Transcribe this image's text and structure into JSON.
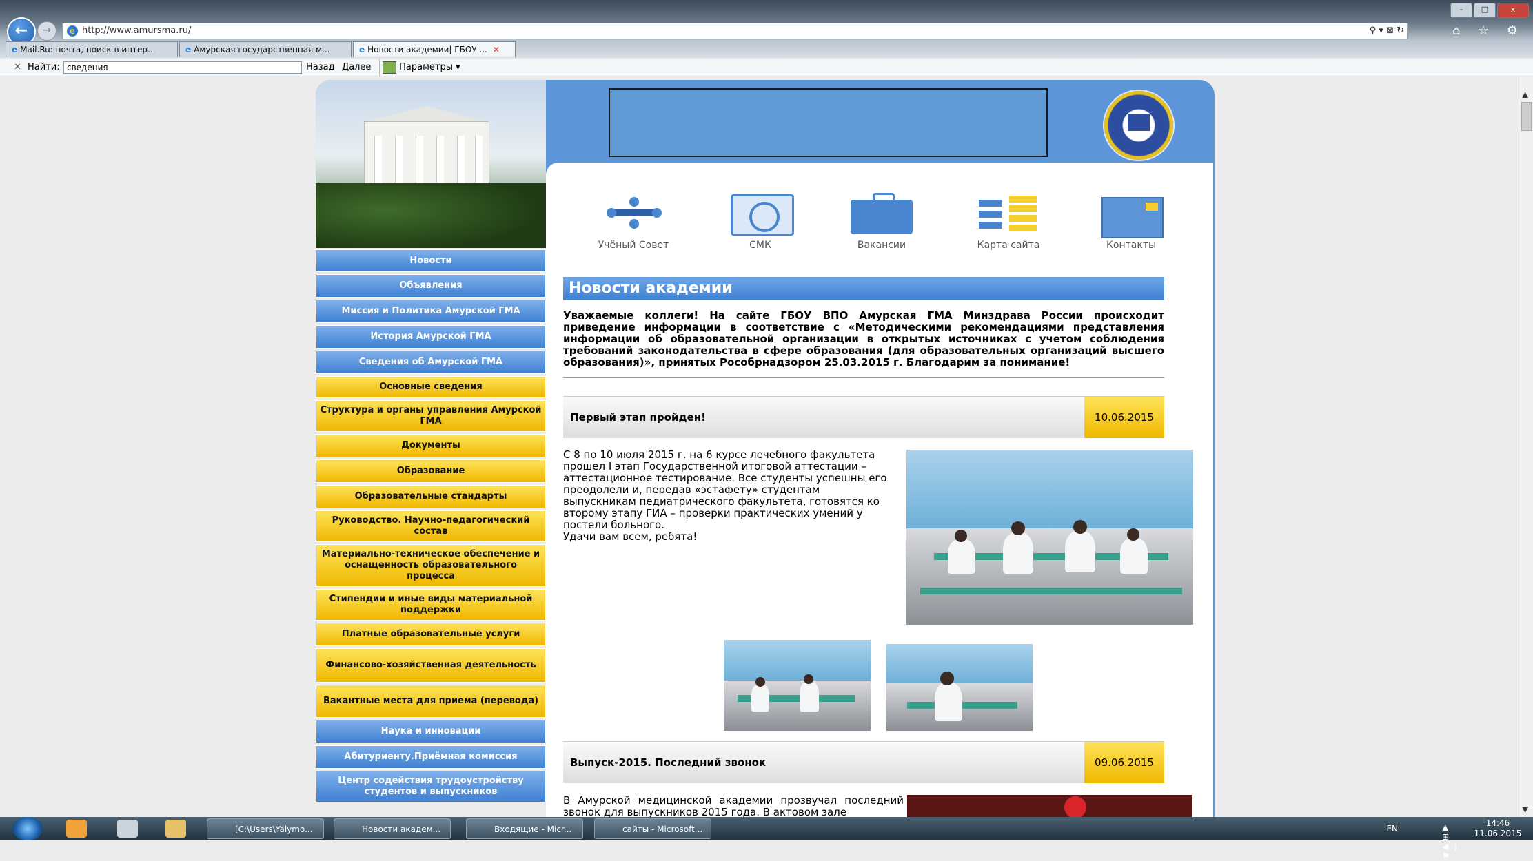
{
  "browser": {
    "url": "http://www.amursma.ru/",
    "addr_tools": "⚲ ▾ ⊠ ↻",
    "right_icons": "⌂ ☆ ⚙",
    "tabs": [
      {
        "label": "Mail.Ru: почта, поиск в интер..."
      },
      {
        "label": "Амурская государственная м..."
      },
      {
        "label": "Новости академии| ГБОУ ..."
      }
    ],
    "window_controls": {
      "minimize": "–",
      "maximize": "□",
      "close": "x"
    }
  },
  "find_bar": {
    "close": "✕",
    "label": "Найти:",
    "value": "сведения",
    "prev": "Назад",
    "next": "Далее",
    "options": "Параметры ▾"
  },
  "site": {
    "icons": [
      {
        "label": "Учёный Совет",
        "icon": "council-icon"
      },
      {
        "label": "СМК",
        "icon": "smk-icon"
      },
      {
        "label": "Вакансии",
        "icon": "briefcase-icon"
      },
      {
        "label": "Карта сайта",
        "icon": "sitemap-icon"
      },
      {
        "label": "Контакты",
        "icon": "envelope-icon"
      }
    ],
    "menu": [
      {
        "label": "Новости",
        "color": "blue"
      },
      {
        "label": "Объявления",
        "color": "blue"
      },
      {
        "label": "Миссия и Политика Амурской ГМА",
        "color": "blue"
      },
      {
        "label": "История Амурской ГМА",
        "color": "blue"
      },
      {
        "label": "Сведения об Амурской ГМА",
        "color": "blue"
      },
      {
        "label": "Основные сведения",
        "color": "yellow"
      },
      {
        "label": "Структура и органы управления Амурской ГМА",
        "color": "yellow"
      },
      {
        "label": "Документы",
        "color": "yellow"
      },
      {
        "label": "Образование",
        "color": "yellow"
      },
      {
        "label": "Образовательные стандарты",
        "color": "yellow"
      },
      {
        "label": "Руководство. Научно-педагогический состав",
        "color": "yellow"
      },
      {
        "label": "Материально-техническое обеспечение и оснащенность образовательного процесса",
        "color": "yellow"
      },
      {
        "label": "Стипендии и иные виды материальной поддержки",
        "color": "yellow"
      },
      {
        "label": "Платные образовательные услуги",
        "color": "yellow"
      },
      {
        "label": "Финансово-хозяйственная деятельность",
        "color": "yellow"
      },
      {
        "label": "Вакантные места для приема (перевода)",
        "color": "yellow"
      },
      {
        "label": "Наука и инновации",
        "color": "blue"
      },
      {
        "label": "Абитуриенту.Приёмная комиссия",
        "color": "blue"
      },
      {
        "label": "Центр содействия трудоустройству студентов и выпускников",
        "color": "blue"
      }
    ],
    "news_heading": "Новости академии",
    "notice": "Уважаемые коллеги! На сайте ГБОУ ВПО Амурская ГМА Минздрава России происходит приведение информации в соответствие с «Методическими рекомендациями представления информации об образовательной организации в открытых источниках с учетом соблюдения требований законодательства в сфере образования (для образовательных организаций высшего образования)», принятых Рособрнадзором 25.03.2015 г. Благодарим за понимание!",
    "posts": [
      {
        "title": "Первый этап пройден!",
        "date": "10.06.2015",
        "text": "С 8 по 10 июля 2015 г. на 6 курсе лечебного факультета прошел  I этап Государственной итоговой аттестации – аттестационное тестирование. Все студенты успешны его преодолели  и, передав «эстафету» студентам выпускникам педиатрического факультета, готовятся ко второму этапу ГИА – проверки практических умений у постели больного.",
        "text2": "Удачи вам всем, ребята!"
      },
      {
        "title": "Выпуск-2015. Последний звонок",
        "date": "09.06.2015",
        "text": "В Амурской медицинской академии прозвучал последний звонок для выпускников 2015 года.  В актовом зале"
      }
    ]
  },
  "taskbar": {
    "buttons": [
      {
        "label": "[C:\\Users\\Yalymo..."
      },
      {
        "label": "Новости академ..."
      },
      {
        "label": "Входящие - Micr..."
      },
      {
        "label": "сайты - Microsoft..."
      }
    ],
    "lang": "EN",
    "tray_icons": "▲ ⊞ ◀) ⚑",
    "time": "14:46",
    "date": "11.06.2015"
  },
  "colors": {
    "accent_blue": "#3f80d2",
    "accent_yellow": "#f0b800"
  }
}
